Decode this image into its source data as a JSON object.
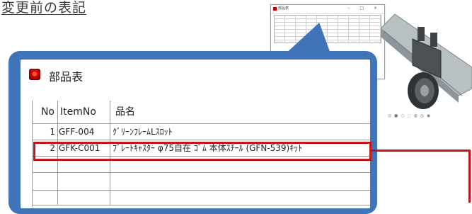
{
  "page_title": "変更前の表記",
  "mini_window": {
    "title": "部品表",
    "controls": "– □ ×"
  },
  "parts_window": {
    "title": "部品表",
    "columns": {
      "no": "No",
      "item_no": "ItemNo",
      "name": "品名"
    },
    "rows": [
      {
        "no": "1",
        "item_no": "GFF-004",
        "name": "ｸﾞﾘｰﾝﾌﾚｰﾑLｽﾛｯﾄ"
      },
      {
        "no": "2",
        "item_no": "GFK-C001",
        "name": "ﾌﾟﾚｰﾄｷｬｽﾀｰ φ75自在 ｺﾞﾑ 本体ｽﾁｰﾙ (GFN-539)ｷｯﾄ"
      },
      {
        "no": "",
        "item_no": "",
        "name": ""
      },
      {
        "no": "",
        "item_no": "",
        "name": ""
      },
      {
        "no": "",
        "item_no": "",
        "name": ""
      }
    ]
  },
  "render_toolbar": "◎ ● ○ ◌ ◍ ◎ ◉",
  "colors": {
    "callout_blue": "#3f74b8",
    "highlight_red": "#c3161c"
  },
  "icons": {
    "app": "app-icon-red"
  }
}
